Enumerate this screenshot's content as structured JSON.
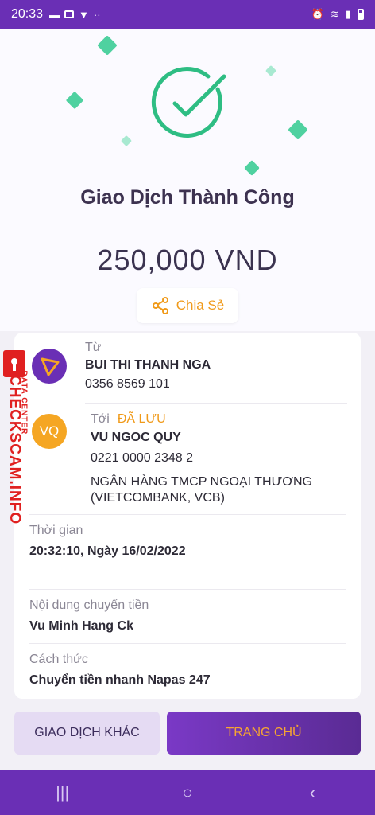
{
  "status_bar": {
    "time": "20:33"
  },
  "success": {
    "title": "Giao Dịch Thành Công",
    "amount": "250,000 VND",
    "share_label": "Chia Sẻ"
  },
  "sender": {
    "label": "Từ",
    "name": "BUI THI THANH NGA",
    "phone": "0356 8569 101"
  },
  "receiver": {
    "label": "Tới",
    "saved_badge": "ĐÃ LƯU",
    "avatar_initials": "VQ",
    "name": "VU NGOC QUY",
    "account": "0221 0000 2348 2",
    "bank_line1": "NGÂN HÀNG TMCP NGOẠI THƯƠNG",
    "bank_line2": "(VIETCOMBANK, VCB)"
  },
  "time": {
    "label": "Thời gian",
    "value": "20:32:10, Ngày 16/02/2022"
  },
  "content": {
    "label": "Nội dung chuyển tiền",
    "value": "Vu Minh Hang Ck"
  },
  "method": {
    "label": "Cách thức",
    "value": "Chuyển tiền nhanh Napas 247"
  },
  "buttons": {
    "other": "GIAO DỊCH KHÁC",
    "home": "TRANG CHỦ"
  },
  "watermark": {
    "main": "CHECKSCAM.INFO",
    "sub": "DATA CENTER"
  },
  "colors": {
    "brand_purple": "#6a2fb5",
    "success_green": "#2ebd83",
    "accent_orange": "#f09a1a"
  },
  "nav": {
    "recents": "|||",
    "home": "○",
    "back": "‹"
  }
}
